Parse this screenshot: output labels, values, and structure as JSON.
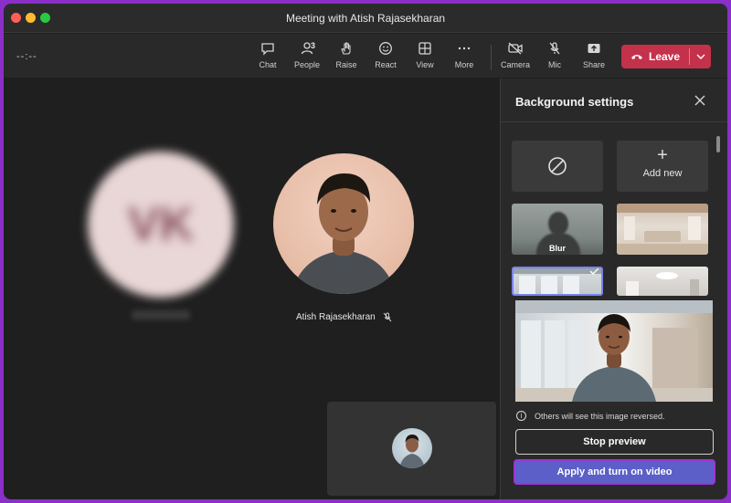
{
  "window": {
    "title": "Meeting with Atish Rajasekharan"
  },
  "toolbar": {
    "timer": "--:--",
    "chat_label": "Chat",
    "people_label": "People",
    "people_count": "3",
    "raise_label": "Raise",
    "react_label": "React",
    "view_label": "View",
    "more_label": "More",
    "camera_label": "Camera",
    "mic_label": "Mic",
    "share_label": "Share",
    "leave_label": "Leave"
  },
  "stage": {
    "blurred_participant_initials": "VK",
    "participant_name": "Atish Rajasekharan"
  },
  "panel": {
    "title": "Background settings",
    "add_new_label": "Add new",
    "blur_label": "Blur",
    "info_text": "Others will see this image reversed.",
    "stop_preview_label": "Stop preview",
    "apply_label": "Apply and turn on video"
  },
  "colors": {
    "leave_red": "#c4314b",
    "accent_purple": "#5b5fc7",
    "highlight_border": "#a033d6"
  },
  "icons": [
    "chat-icon",
    "people-icon",
    "hand-icon",
    "smile-icon",
    "grid-icon",
    "more-icon",
    "camera-off-icon",
    "mic-off-icon",
    "share-icon",
    "phone-icon",
    "chevron-down-icon",
    "close-icon",
    "no-background-icon",
    "plus-icon",
    "info-icon"
  ]
}
